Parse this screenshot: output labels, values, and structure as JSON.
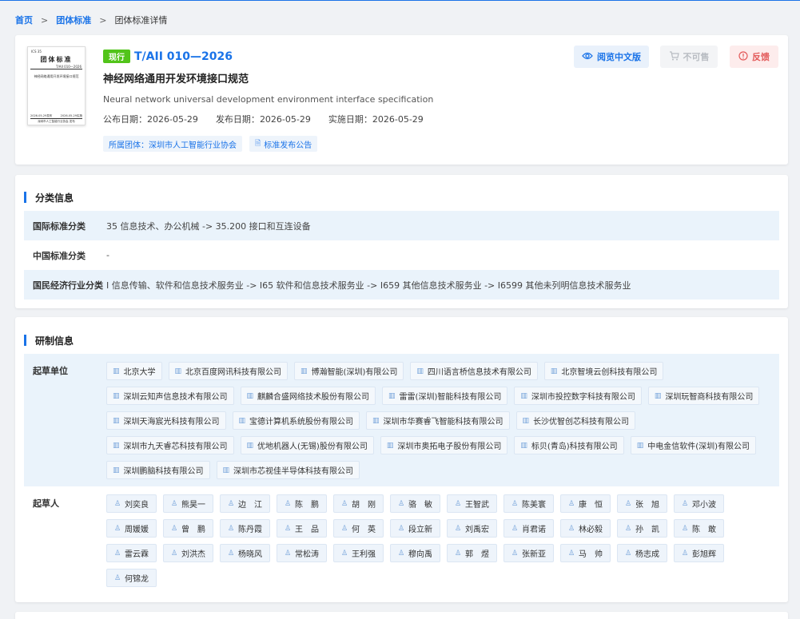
{
  "breadcrumb": {
    "home": "首页",
    "group": "团体标准",
    "current": "团体标准详情"
  },
  "standard": {
    "status": "现行",
    "code": "T/AII 010—2026",
    "title_cn": "神经网络通用开发环境接口规范",
    "title_en": "Neural network universal development environment interface specification",
    "dates": [
      {
        "label": "公布日期：",
        "value": "2026-05-29"
      },
      {
        "label": "发布日期：",
        "value": "2026-05-29"
      },
      {
        "label": "实施日期：",
        "value": "2026-05-29"
      }
    ],
    "org_chip": "所属团体：深圳市人工智能行业协会",
    "notice_chip": "标准发布公告",
    "thumbnail": {
      "top": "ICS 35",
      "heading": "团体标准",
      "code": "T/AII 010—2026",
      "name": "神经网络通用开发环境接口规范",
      "pub": "2026-05-29发布",
      "impl": "2026-05-29实施",
      "org": "深圳市人工智能行业协会 发布"
    }
  },
  "actions": {
    "read": "阅览中文版",
    "not_for_sale": "不可售",
    "feedback": "反馈"
  },
  "classification": {
    "title": "分类信息",
    "rows": [
      {
        "label": "国际标准分类",
        "value": "35 信息技术、办公机械 -> 35.200 接口和互连设备"
      },
      {
        "label": "中国标准分类",
        "value": "-"
      },
      {
        "label": "国民经济行业分类",
        "value": "I 信息传输、软件和信息技术服务业 -> I65 软件和信息技术服务业 -> I659 其他信息技术服务业 -> I6599 其他未列明信息技术服务业"
      }
    ]
  },
  "development": {
    "title": "研制信息",
    "drafting_units_label": "起草单位",
    "drafting_units": [
      "北京大学",
      "北京百度网讯科技有限公司",
      "博瀚智能(深圳)有限公司",
      "四川语言桥信息技术有限公司",
      "北京智境云创科技有限公司",
      "深圳云知声信息技术有限公司",
      "麒麟合盛网络技术股份有限公司",
      "雷雷(深圳)智能科技有限公司",
      "深圳市投控数字科技有限公司",
      "深圳玩智商科技有限公司",
      "深圳天海宸光科技有限公司",
      "宝德计算机系统股份有限公司",
      "深圳市华赛睿飞智能科技有限公司",
      "长沙优智创芯科技有限公司",
      "深圳市九天睿芯科技有限公司",
      "优地机器人(无锡)股份有限公司",
      "深圳市奥拓电子股份有限公司",
      "标贝(青岛)科技有限公司",
      "中电金信软件(深圳)有限公司",
      "深圳鹏脑科技有限公司",
      "深圳市芯视佳半导体科技有限公司"
    ],
    "drafters_label": "起草人",
    "drafters": [
      "刘奕良",
      "熊昊一",
      "边　江",
      "陈　鹏",
      "胡　刚",
      "骆　敏",
      "王智武",
      "陈美寰",
      "康　恒",
      "张　旭",
      "邓小波",
      "周媛媛",
      "曾　鹏",
      "陈丹霞",
      "王　品",
      "何　英",
      "段立新",
      "刘禹宏",
      "肖君诺",
      "林必毅",
      "孙　凯",
      "陈　敢",
      "雷云霖",
      "刘洪杰",
      "杨晓风",
      "常松涛",
      "王利强",
      "穆向禹",
      "郭　煜",
      "张新亚",
      "马　帅",
      "杨志成",
      "彭旭辉",
      "何锦龙"
    ]
  },
  "icons": {
    "accent": "#1a73e8",
    "status_green": "#52c41a",
    "feedback_red": "#e35a5a"
  }
}
